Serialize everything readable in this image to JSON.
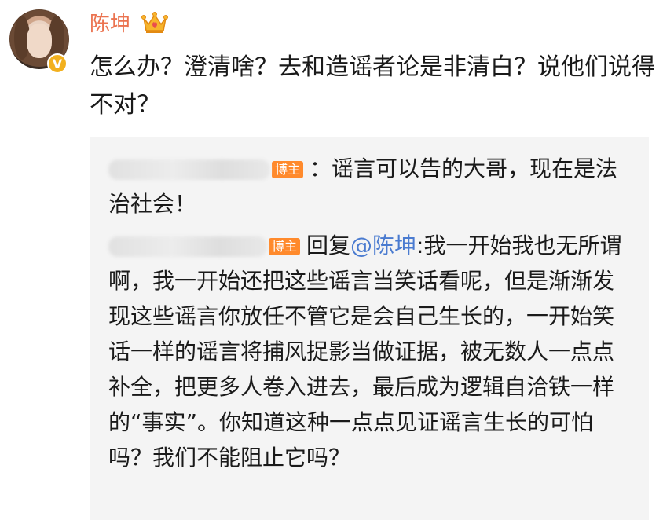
{
  "user": {
    "name": "陈坤"
  },
  "post": {
    "text": "怎么办？澄清啥？去和造谣者论是非清白？说他们说得不对？"
  },
  "comments": [
    {
      "tag": "博主",
      "text": "：谣言可以告的大哥，现在是法治社会！"
    },
    {
      "tag": "博主",
      "reply_prefix": "回复",
      "mention": "@陈坤",
      "text": ":我一开始我也无所谓啊，我一开始还把这些谣言当笑话看呢，但是渐渐发现这些谣言你放任不管它是会自己生长的，一开始笑话一样的谣言将捕风捉影当做证据，被无数人一点点补全，把更多人卷入进去，最后成为逻辑自洽铁一样的“事实”。你知道这种一点点见证谣言生长的可怕吗？我们不能阻止它吗？"
    }
  ],
  "badges": {
    "verified_letter": "V"
  },
  "colors": {
    "username": "#eb7350",
    "mention": "#4a7bd0",
    "blogger_tag": "#ff8a2c",
    "verified_badge": "#f2b01e"
  }
}
